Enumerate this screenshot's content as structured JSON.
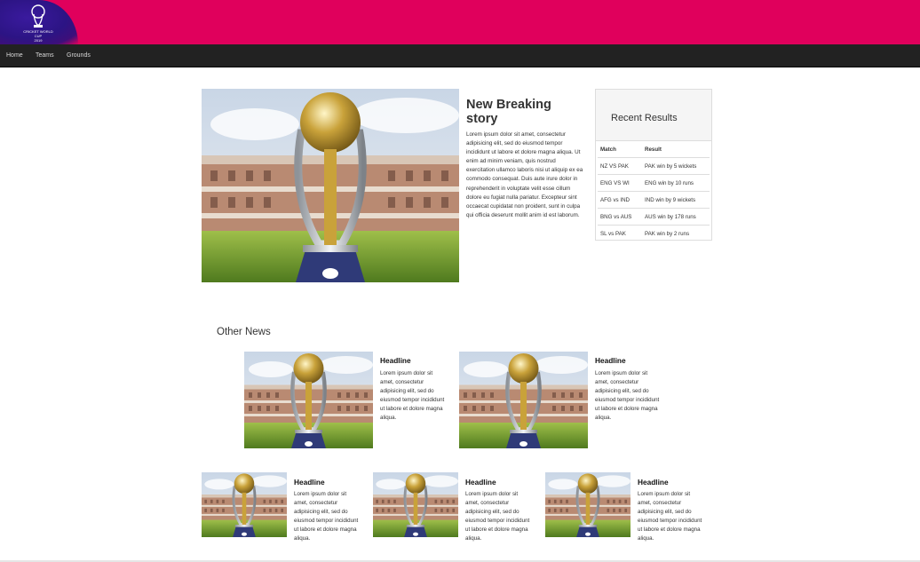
{
  "brand": {
    "logo_alt": "ICC Cricket World Cup England & Wales 2019",
    "logo_text_line1": "CRICKET WORLD CUP",
    "logo_text_line2": "2019",
    "colors": {
      "banner": "#e0005c",
      "logo_bg": "#2c1484",
      "navbar": "#222222"
    }
  },
  "nav": {
    "items": [
      {
        "label": "Home"
      },
      {
        "label": "Teams"
      },
      {
        "label": "Grounds"
      }
    ]
  },
  "featured": {
    "image_icon": "trophy-photo",
    "title": "New Breaking story",
    "body": "Lorem ipsum dolor sit amet, consectetur adipisicing elit, sed do eiusmod tempor incididunt ut labore et dolore magna aliqua. Ut enim ad minim veniam, quis nostrud exercitation ullamco laboris nisi ut aliquip ex ea commodo consequat. Duis aute irure dolor in reprehenderit in voluptate velit esse cillum dolore eu fugiat nulla pariatur. Excepteur sint occaecat cupidatat non proident, sunt in culpa qui officia deserunt mollit anim id est laborum."
  },
  "results": {
    "title": "Recent Results",
    "headers": {
      "match": "Match",
      "result": "Result"
    },
    "rows": [
      {
        "match": "NZ VS PAK",
        "result": "PAK win by 5 wickets"
      },
      {
        "match": "ENG VS WI",
        "result": "ENG win by 10 runs"
      },
      {
        "match": "AFG vs IND",
        "result": "IND win by 9 wickets"
      },
      {
        "match": "BNG vs AUS",
        "result": "AUS win by 178 runs"
      },
      {
        "match": "SL vs PAK",
        "result": "PAK win by 2 runs"
      }
    ]
  },
  "other_news": {
    "title": "Other News",
    "items": [
      {
        "headline": "Headline",
        "body": "Lorem ipsum dolor sit amet, consectetur adipisicing elit, sed do eiusmod tempor incididunt ut labore et dolore magna aliqua."
      },
      {
        "headline": "Headline",
        "body": "Lorem ipsum dolor sit amet, consectetur adipisicing elit, sed do eiusmod tempor incididunt ut labore et dolore magna aliqua."
      },
      {
        "headline": "Headline",
        "body": "Lorem ipsum dolor sit amet, consectetur adipisicing elit, sed do eiusmod tempor incididunt ut labore et dolore magna aliqua."
      },
      {
        "headline": "Headline",
        "body": "Lorem ipsum dolor sit amet, consectetur adipisicing elit, sed do eiusmod tempor incididunt ut labore et dolore magna aliqua."
      },
      {
        "headline": "Headline",
        "body": "Lorem ipsum dolor sit amet, consectetur adipisicing elit, sed do eiusmod tempor incididunt ut labore et dolore magna aliqua."
      }
    ]
  }
}
